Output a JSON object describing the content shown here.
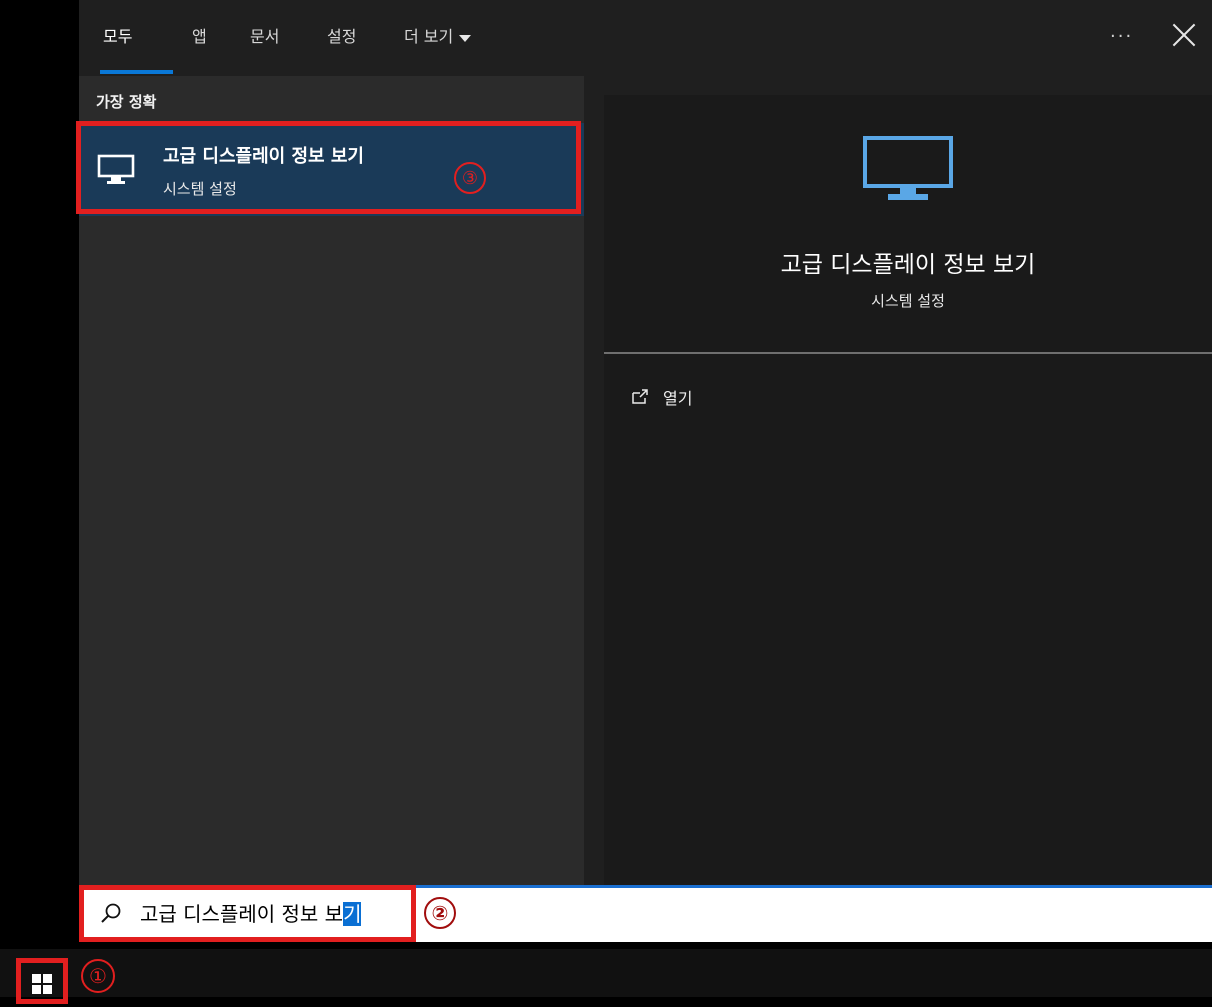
{
  "tabs": [
    {
      "label": "모두"
    },
    {
      "label": "앱"
    },
    {
      "label": "문서"
    },
    {
      "label": "설정"
    },
    {
      "label": "더 보기"
    }
  ],
  "header": {
    "ellipsis": "···"
  },
  "results": {
    "section_title": "가장 정확",
    "best": {
      "title": "고급 디스플레이 정보 보기",
      "subtitle": "시스템 설정"
    }
  },
  "preview": {
    "title": "고급 디스플레이 정보 보기",
    "subtitle": "시스템 설정",
    "action_open": "열기"
  },
  "search": {
    "typed_prefix": "고급 디스플레이 정보 보",
    "selected_suffix": "기"
  },
  "annotations": {
    "one": "①",
    "two": "②",
    "three": "③"
  },
  "colors": {
    "accent": "#0a78d7",
    "annotation_red": "#e21f1f",
    "selected_bg": "#1a3a58",
    "preview_icon": "#5aa7e6"
  }
}
